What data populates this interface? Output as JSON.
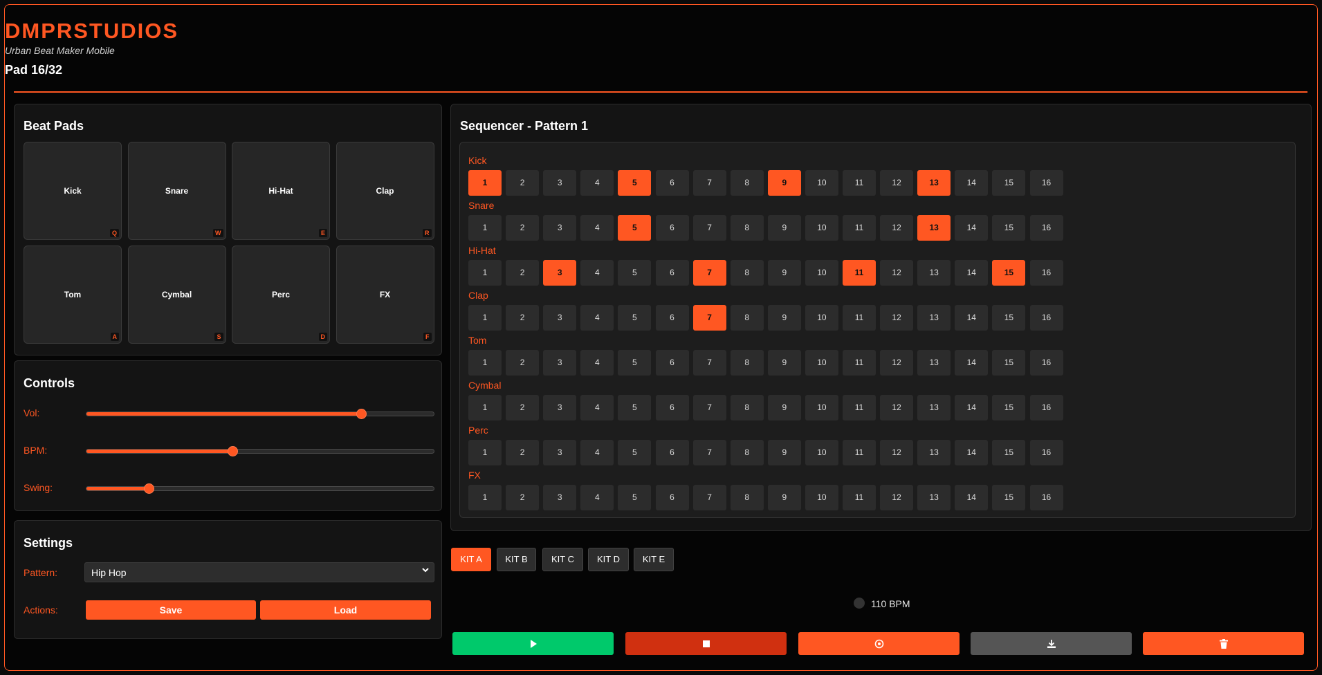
{
  "header": {
    "brand": "DMPRSTUDIOS",
    "subtitle": "Urban Beat Maker Mobile",
    "pad_count": "Pad 16/32"
  },
  "beat_pads": {
    "title": "Beat Pads",
    "pads": [
      {
        "label": "Kick",
        "key": "Q"
      },
      {
        "label": "Snare",
        "key": "W"
      },
      {
        "label": "Hi-Hat",
        "key": "E"
      },
      {
        "label": "Clap",
        "key": "R"
      },
      {
        "label": "Tom",
        "key": "A"
      },
      {
        "label": "Cymbal",
        "key": "S"
      },
      {
        "label": "Perc",
        "key": "D"
      },
      {
        "label": "FX",
        "key": "F"
      }
    ]
  },
  "controls": {
    "title": "Controls",
    "sliders": [
      {
        "label": "Vol:",
        "value": 0.79
      },
      {
        "label": "BPM:",
        "value": 0.42
      },
      {
        "label": "Swing:",
        "value": 0.18
      }
    ]
  },
  "settings": {
    "title": "Settings",
    "pattern_label": "Pattern:",
    "pattern_value": "Hip Hop",
    "actions_label": "Actions:",
    "save_label": "Save",
    "load_label": "Load"
  },
  "sequencer": {
    "title": "Sequencer - Pattern 1",
    "steps": [
      "1",
      "2",
      "3",
      "4",
      "5",
      "6",
      "7",
      "8",
      "9",
      "10",
      "11",
      "12",
      "13",
      "14",
      "15",
      "16"
    ],
    "tracks": [
      {
        "name": "Kick",
        "active": [
          1,
          5,
          9,
          13
        ]
      },
      {
        "name": "Snare",
        "active": [
          5,
          13
        ]
      },
      {
        "name": "Hi-Hat",
        "active": [
          3,
          7,
          11,
          15
        ]
      },
      {
        "name": "Clap",
        "active": [
          7
        ]
      },
      {
        "name": "Tom",
        "active": []
      },
      {
        "name": "Cymbal",
        "active": []
      },
      {
        "name": "Perc",
        "active": []
      },
      {
        "name": "FX",
        "active": []
      }
    ]
  },
  "kits": {
    "items": [
      "KIT A",
      "KIT B",
      "KIT C",
      "KIT D",
      "KIT E"
    ],
    "selected": "KIT A"
  },
  "tempo_display": "110 BPM",
  "transport": {
    "buttons": [
      {
        "name": "play",
        "icon": "play-icon",
        "color": "#00c96b"
      },
      {
        "name": "stop",
        "icon": "stop-icon",
        "color": "#d03010"
      },
      {
        "name": "record",
        "icon": "record-icon",
        "color": "#ff5722"
      },
      {
        "name": "download",
        "icon": "download-icon",
        "color": "#555555"
      },
      {
        "name": "clear",
        "icon": "trash-icon",
        "color": "#ff5722"
      }
    ]
  },
  "colors": {
    "accent": "#ff5722",
    "background": "#050505",
    "panel": "#141414",
    "step_off": "#2c2c2c"
  }
}
